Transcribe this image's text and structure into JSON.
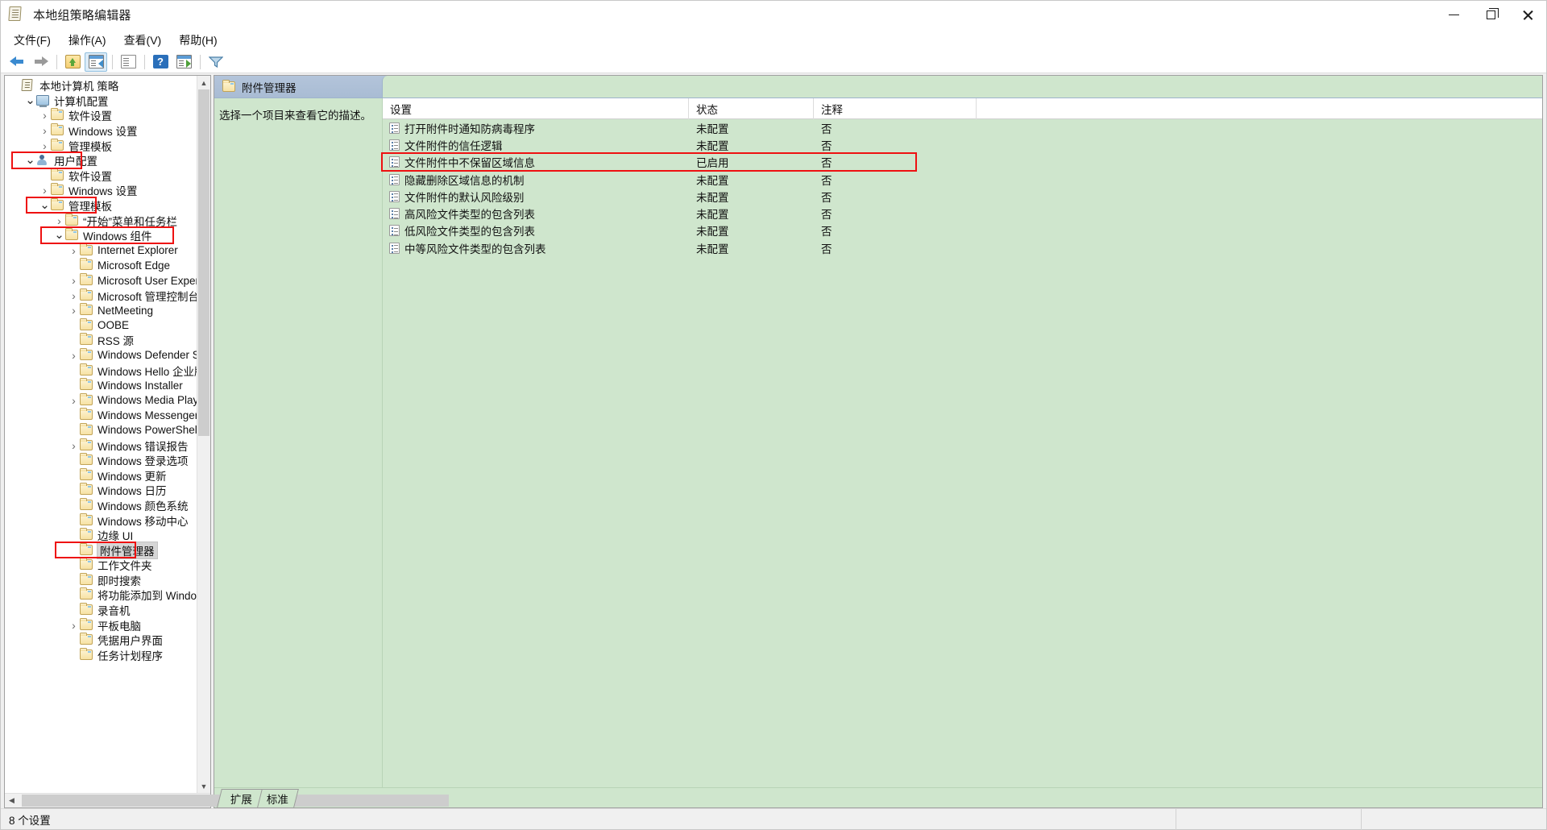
{
  "window": {
    "title": "本地组策略编辑器",
    "icon": "policy-document-icon",
    "minimize_label": "最小化",
    "maximize_label": "最大化",
    "close_label": "关闭"
  },
  "menubar": {
    "items": [
      {
        "label": "文件(F)",
        "name": "menu-file"
      },
      {
        "label": "操作(A)",
        "name": "menu-action"
      },
      {
        "label": "查看(V)",
        "name": "menu-view"
      },
      {
        "label": "帮助(H)",
        "name": "menu-help"
      }
    ]
  },
  "toolbar": {
    "buttons": [
      {
        "name": "back-button",
        "icon": "arrow-left-icon"
      },
      {
        "name": "forward-button",
        "icon": "arrow-right-icon"
      },
      {
        "name": "up-one-level-button",
        "icon": "folder-up-icon"
      },
      {
        "name": "show-hide-console-tree-button",
        "icon": "console-tree-icon"
      },
      {
        "name": "export-list-button",
        "icon": "export-list-icon"
      },
      {
        "name": "help-button",
        "icon": "help-icon"
      },
      {
        "name": "show-hide-action-pane-button",
        "icon": "action-pane-icon"
      },
      {
        "name": "filter-button",
        "icon": "filter-icon"
      }
    ]
  },
  "tree": {
    "nodes": [
      {
        "label": "本地计算机 策略",
        "indent": 0,
        "chev": "none",
        "icon": "policy-root-icon",
        "highlight": false,
        "selected": false
      },
      {
        "label": "计算机配置",
        "indent": 1,
        "chev": "open",
        "icon": "computer-icon",
        "highlight": false,
        "selected": false
      },
      {
        "label": "软件设置",
        "indent": 2,
        "chev": "closed",
        "icon": "folder-icon",
        "highlight": false,
        "selected": false
      },
      {
        "label": "Windows 设置",
        "indent": 2,
        "chev": "closed",
        "icon": "folder-icon",
        "highlight": false,
        "selected": false
      },
      {
        "label": "管理模板",
        "indent": 2,
        "chev": "closed",
        "icon": "folder-icon",
        "highlight": false,
        "selected": false
      },
      {
        "label": "用户配置",
        "indent": 1,
        "chev": "open",
        "icon": "user-icon",
        "highlight": true,
        "selected": false
      },
      {
        "label": "软件设置",
        "indent": 2,
        "chev": "none",
        "icon": "folder-icon",
        "highlight": false,
        "selected": false
      },
      {
        "label": "Windows 设置",
        "indent": 2,
        "chev": "closed",
        "icon": "folder-icon",
        "highlight": false,
        "selected": false
      },
      {
        "label": "管理模板",
        "indent": 2,
        "chev": "open",
        "icon": "folder-icon",
        "highlight": true,
        "selected": false
      },
      {
        "label": "“开始”菜单和任务栏",
        "indent": 3,
        "chev": "closed",
        "icon": "folder-icon",
        "highlight": false,
        "selected": false
      },
      {
        "label": "Windows 组件",
        "indent": 3,
        "chev": "open",
        "icon": "folder-icon",
        "highlight": true,
        "selected": false
      },
      {
        "label": "Internet Explorer",
        "indent": 4,
        "chev": "closed",
        "icon": "folder-icon",
        "highlight": false,
        "selected": false
      },
      {
        "label": "Microsoft Edge",
        "indent": 4,
        "chev": "none",
        "icon": "folder-icon",
        "highlight": false,
        "selected": false
      },
      {
        "label": "Microsoft User Experien",
        "indent": 4,
        "chev": "closed",
        "icon": "folder-icon",
        "highlight": false,
        "selected": false
      },
      {
        "label": "Microsoft 管理控制台",
        "indent": 4,
        "chev": "closed",
        "icon": "folder-icon",
        "highlight": false,
        "selected": false
      },
      {
        "label": "NetMeeting",
        "indent": 4,
        "chev": "closed",
        "icon": "folder-icon",
        "highlight": false,
        "selected": false
      },
      {
        "label": "OOBE",
        "indent": 4,
        "chev": "none",
        "icon": "folder-icon",
        "highlight": false,
        "selected": false
      },
      {
        "label": "RSS 源",
        "indent": 4,
        "chev": "none",
        "icon": "folder-icon",
        "highlight": false,
        "selected": false
      },
      {
        "label": "Windows Defender Sma",
        "indent": 4,
        "chev": "closed",
        "icon": "folder-icon",
        "highlight": false,
        "selected": false
      },
      {
        "label": "Windows Hello 企业版",
        "indent": 4,
        "chev": "none",
        "icon": "folder-icon",
        "highlight": false,
        "selected": false
      },
      {
        "label": "Windows Installer",
        "indent": 4,
        "chev": "none",
        "icon": "folder-icon",
        "highlight": false,
        "selected": false
      },
      {
        "label": "Windows Media Player",
        "indent": 4,
        "chev": "closed",
        "icon": "folder-icon",
        "highlight": false,
        "selected": false
      },
      {
        "label": "Windows Messenger",
        "indent": 4,
        "chev": "none",
        "icon": "folder-icon",
        "highlight": false,
        "selected": false
      },
      {
        "label": "Windows PowerShell",
        "indent": 4,
        "chev": "none",
        "icon": "folder-icon",
        "highlight": false,
        "selected": false
      },
      {
        "label": "Windows 错误报告",
        "indent": 4,
        "chev": "closed",
        "icon": "folder-icon",
        "highlight": false,
        "selected": false
      },
      {
        "label": "Windows 登录选项",
        "indent": 4,
        "chev": "none",
        "icon": "folder-icon",
        "highlight": false,
        "selected": false
      },
      {
        "label": "Windows 更新",
        "indent": 4,
        "chev": "none",
        "icon": "folder-icon",
        "highlight": false,
        "selected": false
      },
      {
        "label": "Windows 日历",
        "indent": 4,
        "chev": "none",
        "icon": "folder-icon",
        "highlight": false,
        "selected": false
      },
      {
        "label": "Windows 颜色系统",
        "indent": 4,
        "chev": "none",
        "icon": "folder-icon",
        "highlight": false,
        "selected": false
      },
      {
        "label": "Windows 移动中心",
        "indent": 4,
        "chev": "none",
        "icon": "folder-icon",
        "highlight": false,
        "selected": false
      },
      {
        "label": "边缘 UI",
        "indent": 4,
        "chev": "none",
        "icon": "folder-icon",
        "highlight": false,
        "selected": false
      },
      {
        "label": "附件管理器",
        "indent": 4,
        "chev": "none",
        "icon": "folder-icon",
        "highlight": true,
        "selected": true
      },
      {
        "label": "工作文件夹",
        "indent": 4,
        "chev": "none",
        "icon": "folder-icon",
        "highlight": false,
        "selected": false
      },
      {
        "label": "即时搜索",
        "indent": 4,
        "chev": "none",
        "icon": "folder-icon",
        "highlight": false,
        "selected": false
      },
      {
        "label": "将功能添加到 Windows",
        "indent": 4,
        "chev": "none",
        "icon": "folder-icon",
        "highlight": false,
        "selected": false
      },
      {
        "label": "录音机",
        "indent": 4,
        "chev": "none",
        "icon": "folder-icon",
        "highlight": false,
        "selected": false
      },
      {
        "label": "平板电脑",
        "indent": 4,
        "chev": "closed",
        "icon": "folder-icon",
        "highlight": false,
        "selected": false
      },
      {
        "label": "凭据用户界面",
        "indent": 4,
        "chev": "none",
        "icon": "folder-icon",
        "highlight": false,
        "selected": false
      },
      {
        "label": "任务计划程序",
        "indent": 4,
        "chev": "none",
        "icon": "folder-icon",
        "highlight": false,
        "selected": false
      }
    ]
  },
  "right_pane": {
    "header_title": "附件管理器",
    "header_icon": "folder-icon",
    "description": "选择一个项目来查看它的描述。",
    "columns": [
      {
        "label": "设置",
        "name": "column-setting"
      },
      {
        "label": "状态",
        "name": "column-state"
      },
      {
        "label": "注释",
        "name": "column-comment"
      }
    ],
    "rows": [
      {
        "setting": "打开附件时通知防病毒程序",
        "state": "未配置",
        "comment": "否",
        "highlight": false
      },
      {
        "setting": "文件附件的信任逻辑",
        "state": "未配置",
        "comment": "否",
        "highlight": false
      },
      {
        "setting": "文件附件中不保留区域信息",
        "state": "已启用",
        "comment": "否",
        "highlight": true
      },
      {
        "setting": "隐藏删除区域信息的机制",
        "state": "未配置",
        "comment": "否",
        "highlight": false
      },
      {
        "setting": "文件附件的默认风险级别",
        "state": "未配置",
        "comment": "否",
        "highlight": false
      },
      {
        "setting": "高风险文件类型的包含列表",
        "state": "未配置",
        "comment": "否",
        "highlight": false
      },
      {
        "setting": "低风险文件类型的包含列表",
        "state": "未配置",
        "comment": "否",
        "highlight": false
      },
      {
        "setting": "中等风险文件类型的包含列表",
        "state": "未配置",
        "comment": "否",
        "highlight": false
      }
    ],
    "tabs": [
      {
        "label": "扩展",
        "active": true,
        "name": "tab-extended"
      },
      {
        "label": "标准",
        "active": false,
        "name": "tab-standard"
      }
    ]
  },
  "statusbar": {
    "text": "8 个设置"
  },
  "colors": {
    "highlight_red": "#ee1111",
    "pane_green": "#cfe6cd",
    "header_blue": "#b3c4da",
    "selection_gray": "#d6d6d6"
  }
}
